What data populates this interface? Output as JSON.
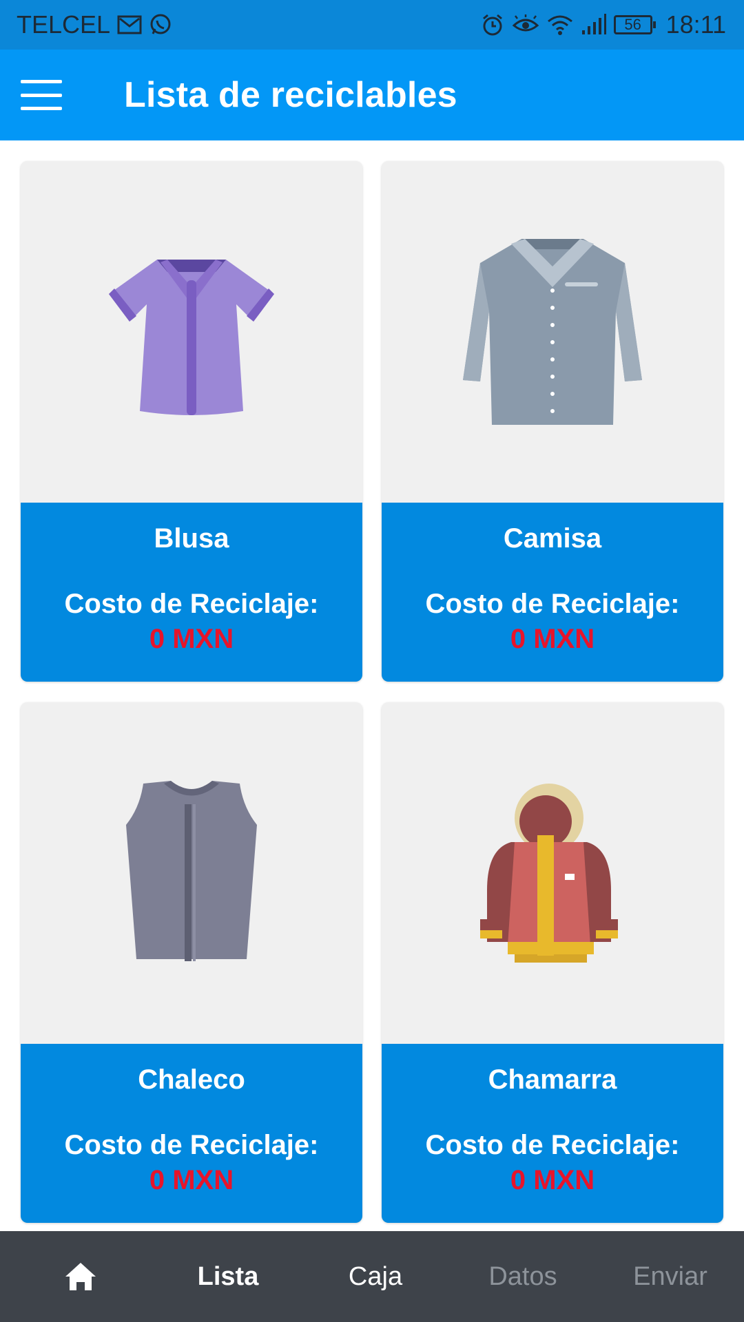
{
  "status_bar": {
    "carrier": "TELCEL",
    "battery": "56",
    "time": "18:11",
    "icons": [
      "mail-icon",
      "whatsapp-icon",
      "alarm-icon",
      "eye-icon",
      "wifi-icon",
      "signal-icon",
      "battery-icon"
    ]
  },
  "appbar": {
    "title": "Lista de reciclables",
    "menu_icon": "hamburger-menu-icon"
  },
  "items": [
    {
      "name": "Blusa",
      "cost_label": "Costo de Reciclaje:",
      "cost": "0 MXN",
      "icon": "blouse-icon"
    },
    {
      "name": "Camisa",
      "cost_label": "Costo de Reciclaje:",
      "cost": "0 MXN",
      "icon": "shirt-icon"
    },
    {
      "name": "Chaleco",
      "cost_label": "Costo de Reciclaje:",
      "cost": "0 MXN",
      "icon": "vest-icon"
    },
    {
      "name": "Chamarra",
      "cost_label": "Costo de Reciclaje:",
      "cost": "0 MXN",
      "icon": "jacket-icon"
    }
  ],
  "bottom_nav": {
    "home_icon": "home-icon",
    "tabs": [
      {
        "label": "Lista",
        "state": "active"
      },
      {
        "label": "Caja",
        "state": "enabled"
      },
      {
        "label": "Datos",
        "state": "disabled"
      },
      {
        "label": "Enviar",
        "state": "disabled"
      }
    ]
  },
  "colors": {
    "status_bar": "#0b87d8",
    "app_bar": "#0397f6",
    "card_info": "#0289df",
    "card_image_bg": "#f0f0f0",
    "cost_red": "#e8142a",
    "bottom_nav": "#3e434a",
    "nav_active": "#ffffff",
    "nav_enabled": "#ffffff",
    "nav_disabled": "#8d939a"
  }
}
